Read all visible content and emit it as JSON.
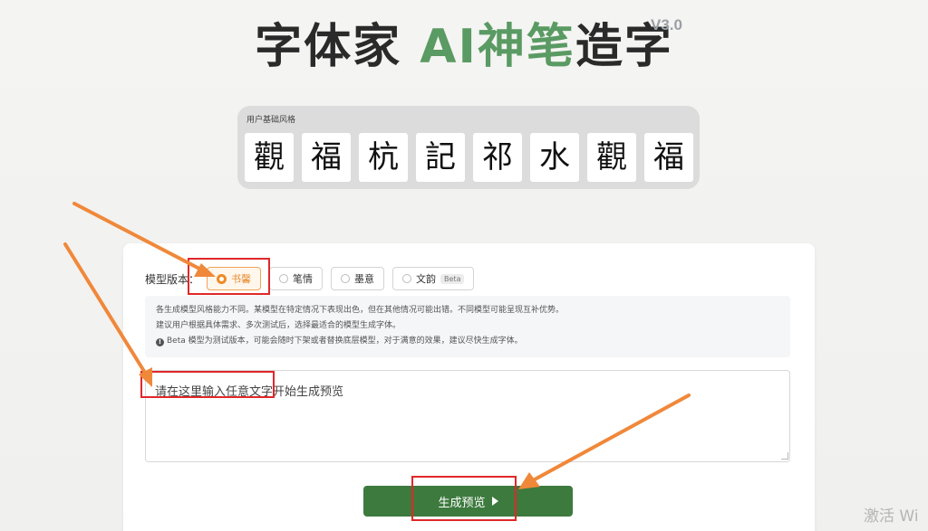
{
  "header": {
    "title_prefix": "字体家 ",
    "title_accent": "AI神笔",
    "title_suffix": "造字",
    "version": "V3.0"
  },
  "styles_panel": {
    "label": "用户基础风格",
    "glyphs": [
      "觀",
      "福",
      "杭",
      "記",
      "祁",
      "水",
      "觀",
      "福"
    ]
  },
  "model_selector": {
    "label": "模型版本：",
    "options": [
      {
        "label": "书馨",
        "selected": true
      },
      {
        "label": "笔情",
        "selected": false
      },
      {
        "label": "墨意",
        "selected": false
      },
      {
        "label": "文韵",
        "selected": false,
        "badge": "Beta"
      }
    ]
  },
  "info": {
    "line1": "各生成模型风格能力不同。某模型在特定情况下表现出色，但在其他情况可能出错。不同模型可能呈现互补优势。",
    "line2": "建议用户根据具体需求、多次测试后，选择最适合的模型生成字体。",
    "line3": "Beta 模型为测试版本，可能会随时下架或者替换底层模型，对于满意的效果，建议尽快生成字体。"
  },
  "input": {
    "placeholder": "请在这里输入任意文字开始生成预览",
    "value": ""
  },
  "generate_button": {
    "label": "生成预览"
  },
  "watermark": {
    "text": "激活 Wi"
  },
  "colors": {
    "accent_green": "#5a9a63",
    "button_green": "#3d7a3e",
    "selected_orange": "#f08a24",
    "highlight_red": "#e0282a",
    "arrow_orange": "#f0883a"
  }
}
